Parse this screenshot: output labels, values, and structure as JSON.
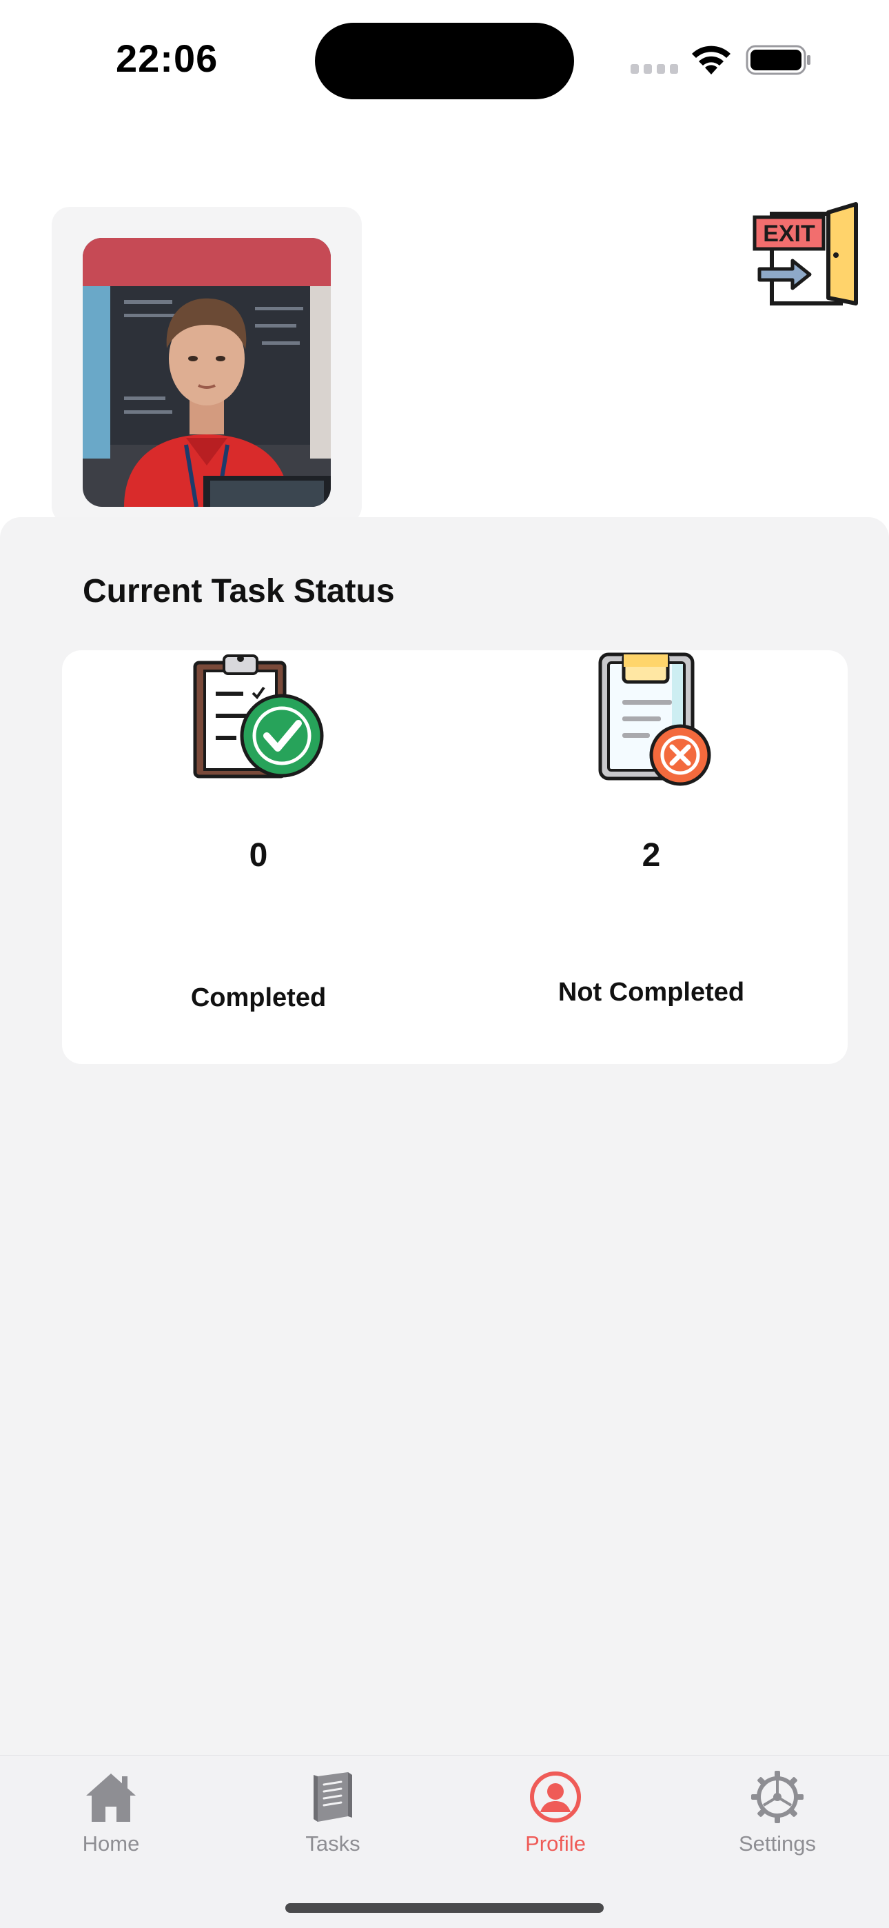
{
  "status_bar": {
    "time": "22:06"
  },
  "header": {
    "avatar_label": "profile photo",
    "exit_sign_text": "EXIT"
  },
  "task_status": {
    "title": "Current Task Status",
    "completed": {
      "count": "0",
      "label": "Completed",
      "icon": "clipboard-check-icon",
      "color": "#27a35a"
    },
    "not_completed": {
      "count": "2",
      "label": "Not Completed",
      "icon": "clipboard-x-icon",
      "color": "#f36a3d"
    }
  },
  "tab_bar": {
    "tabs": [
      {
        "label": "Home",
        "icon": "home-icon",
        "active": false
      },
      {
        "label": "Tasks",
        "icon": "book-icon",
        "active": false
      },
      {
        "label": "Profile",
        "icon": "person-circle-icon",
        "active": true
      },
      {
        "label": "Settings",
        "icon": "gear-icon",
        "active": false
      }
    ],
    "active_color": "#ef5b57",
    "inactive_color": "#8e8e93"
  }
}
